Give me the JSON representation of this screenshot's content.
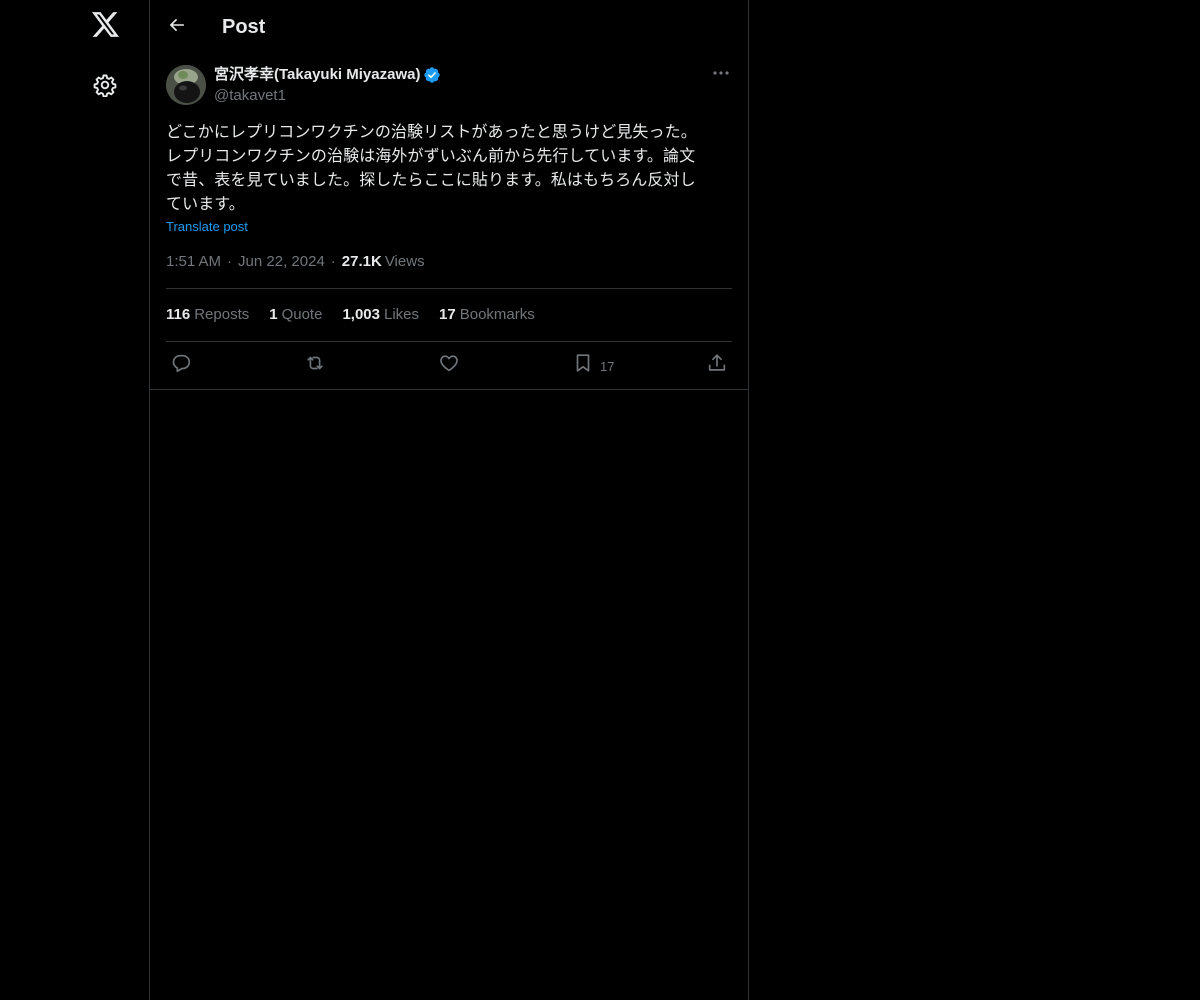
{
  "nav": {
    "logo_icon": "x-logo-icon",
    "settings_icon": "gear-icon"
  },
  "header": {
    "back_icon": "arrow-left-icon",
    "title": "Post"
  },
  "post": {
    "author": {
      "name": "宮沢孝幸(Takayuki Miyazawa)",
      "handle": "@takavet1",
      "verified": true,
      "verified_color": "#1d9bf0"
    },
    "text_lines": [
      "どこかにレプリコンワクチンの治験リストがあったと思うけど見失った。",
      "レプリコンワクチンの治験は海外がずいぶん前から先行しています。論文",
      "で昔、表を見ていました。探したらここに貼ります。私はもちろん反対し",
      "ています。"
    ],
    "translate_label": "Translate post",
    "time": "1:51 AM",
    "date": "Jun 22, 2024",
    "views_count": "27.1K",
    "views_label": "Views",
    "stats": {
      "reposts": {
        "count": "116",
        "label": "Reposts"
      },
      "quotes": {
        "count": "1",
        "label": "Quote"
      },
      "likes": {
        "count": "1,003",
        "label": "Likes"
      },
      "bookmarks": {
        "count": "17",
        "label": "Bookmarks"
      }
    },
    "actions": {
      "reply_icon": "reply-icon",
      "repost_icon": "repost-icon",
      "like_icon": "heart-icon",
      "bookmark_icon": "bookmark-icon",
      "bookmark_count": "17",
      "share_icon": "share-icon"
    }
  },
  "colors": {
    "background": "#000000",
    "text_primary": "#e7e9ea",
    "text_secondary": "#71767b",
    "border": "#2f3336",
    "accent": "#1d9bf0"
  }
}
